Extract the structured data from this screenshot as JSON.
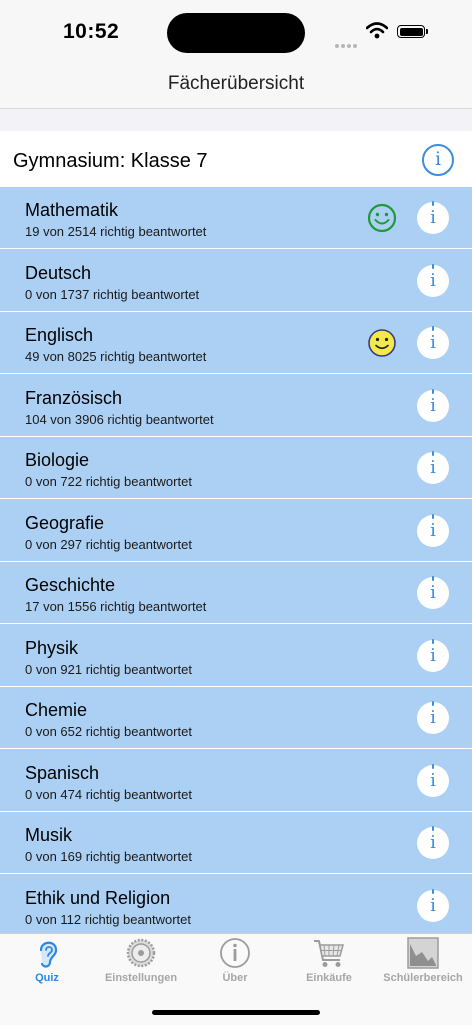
{
  "status_bar": {
    "time": "10:52"
  },
  "nav": {
    "title": "Fächerübersicht"
  },
  "section": {
    "title": "Gymnasium: Klasse 7",
    "info_glyph": "i"
  },
  "subjects": [
    {
      "name": "Mathematik",
      "progress": "19 von 2514 richtig beantwortet",
      "smiley": "green",
      "info_glyph": "i"
    },
    {
      "name": "Deutsch",
      "progress": "0 von 1737 richtig beantwortet",
      "smiley": null,
      "info_glyph": "i"
    },
    {
      "name": "Englisch",
      "progress": "49 von 8025 richtig beantwortet",
      "smiley": "yellow",
      "info_glyph": "i"
    },
    {
      "name": "Französisch",
      "progress": "104 von 3906 richtig beantwortet",
      "smiley": null,
      "info_glyph": "i"
    },
    {
      "name": "Biologie",
      "progress": "0 von 722 richtig beantwortet",
      "smiley": null,
      "info_glyph": "i"
    },
    {
      "name": "Geografie",
      "progress": "0 von 297 richtig beantwortet",
      "smiley": null,
      "info_glyph": "i"
    },
    {
      "name": "Geschichte",
      "progress": "17 von 1556 richtig beantwortet",
      "smiley": null,
      "info_glyph": "i"
    },
    {
      "name": "Physik",
      "progress": "0 von 921 richtig beantwortet",
      "smiley": null,
      "info_glyph": "i"
    },
    {
      "name": "Chemie",
      "progress": "0 von 652 richtig beantwortet",
      "smiley": null,
      "info_glyph": "i"
    },
    {
      "name": "Spanisch",
      "progress": "0 von 474 richtig beantwortet",
      "smiley": null,
      "info_glyph": "i"
    },
    {
      "name": "Musik",
      "progress": "0 von 169 richtig beantwortet",
      "smiley": null,
      "info_glyph": "i"
    },
    {
      "name": "Ethik und Religion",
      "progress": "0 von 112 richtig beantwortet",
      "smiley": null,
      "info_glyph": "i"
    }
  ],
  "tabs": [
    {
      "label": "Quiz",
      "icon": "ear-icon",
      "active": true
    },
    {
      "label": "Einstellungen",
      "icon": "gear-icon",
      "active": false
    },
    {
      "label": "Über",
      "icon": "info-icon",
      "active": false
    },
    {
      "label": "Einkäufe",
      "icon": "cart-icon",
      "active": false
    },
    {
      "label": "Schülerbereich",
      "icon": "chart-icon",
      "active": false
    }
  ],
  "colors": {
    "row_background": "#acd0f3",
    "accent": "#2a88e5",
    "smiley_green": "#1f9a3a",
    "smiley_yellow": "#f3e94a"
  }
}
